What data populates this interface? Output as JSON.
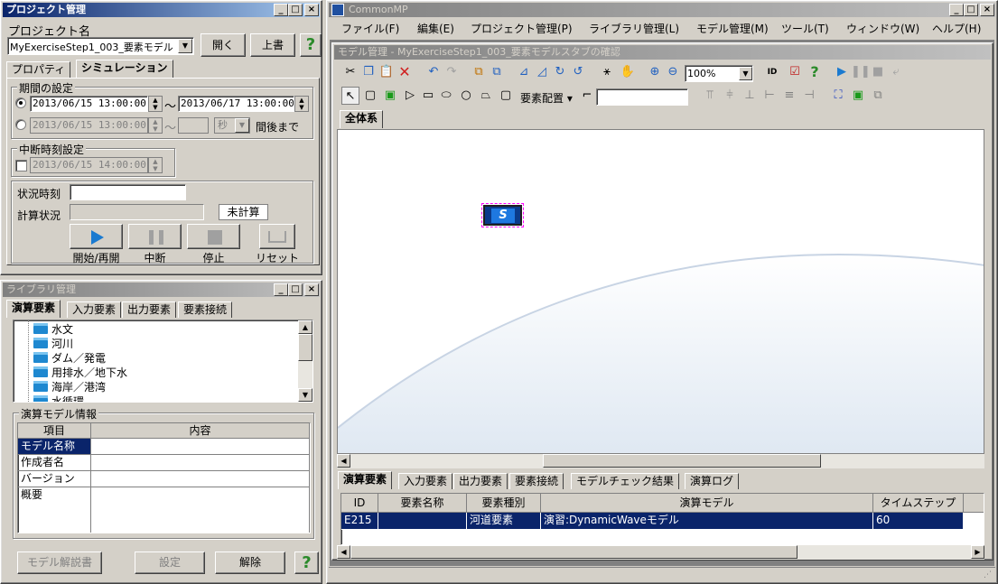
{
  "project_win": {
    "title": "プロジェクト管理",
    "project_label": "プロジェクト名",
    "project_value": "MyExerciseStep1_003_要素モデル",
    "open_btn": "開く",
    "overwrite_btn": "上書",
    "tabs": [
      "プロパティ",
      "シミュレーション"
    ],
    "period": {
      "label": "期間の設定",
      "start": "2013/06/15 13:00:00",
      "end": "2013/06/17 13:00:00",
      "start2": "2013/06/15 13:00:00",
      "unit": "秒",
      "until_text": "間後まで"
    },
    "interrupt": {
      "label": "中断時刻設定",
      "value": "2013/06/15 14:00:00"
    },
    "status": {
      "time_label": "状況時刻",
      "calc_label": "計算状況",
      "calc_value": "未計算"
    },
    "controls": [
      "開始/再開",
      "中断",
      "停止",
      "リセット"
    ]
  },
  "library_win": {
    "title": "ライブラリ管理",
    "tabs": [
      "演算要素",
      "入力要素",
      "出力要素",
      "要素接続"
    ],
    "tree": [
      "水文",
      "河川",
      "ダム／発電",
      "用排水／地下水",
      "海岸／港湾",
      "水循環"
    ],
    "info_label": "演算モデル情報",
    "info_header": [
      "項目",
      "内容"
    ],
    "info_rows": [
      "モデル名称",
      "作成者名",
      "バージョン",
      "概要"
    ],
    "buttons": [
      "モデル解説書",
      "設定",
      "解除"
    ]
  },
  "main_win": {
    "title": "CommonMP",
    "menu": [
      "ファイル(F)",
      "編集(E)",
      "プロジェクト管理(P)",
      "ライブラリ管理(L)",
      "モデル管理(M)",
      "ツール(T)",
      "ウィンドウ(W)",
      "ヘルプ(H)"
    ],
    "model_title": "モデル管理 - MyExerciseStep1_003_要素モデルスタブの確認",
    "zoom": "100%",
    "layout_dropdown": "要素配置",
    "canvas_tab": "全体系",
    "bottom_tabs": [
      "演算要素",
      "入力要素",
      "出力要素",
      "要素接続",
      "モデルチェック結果",
      "演算ログ"
    ],
    "grid_header": [
      "ID",
      "要素名称",
      "要素種別",
      "演算モデル",
      "タイムステップ"
    ],
    "grid_rows": [
      {
        "id": "E215",
        "name": "",
        "kind": "河道要素",
        "model": "演習:DynamicWaveモデル",
        "step": "60"
      }
    ]
  },
  "colors": {
    "active_title": "#0a246a",
    "selection": "#0a246a",
    "help_green": "#2a8a2a"
  }
}
